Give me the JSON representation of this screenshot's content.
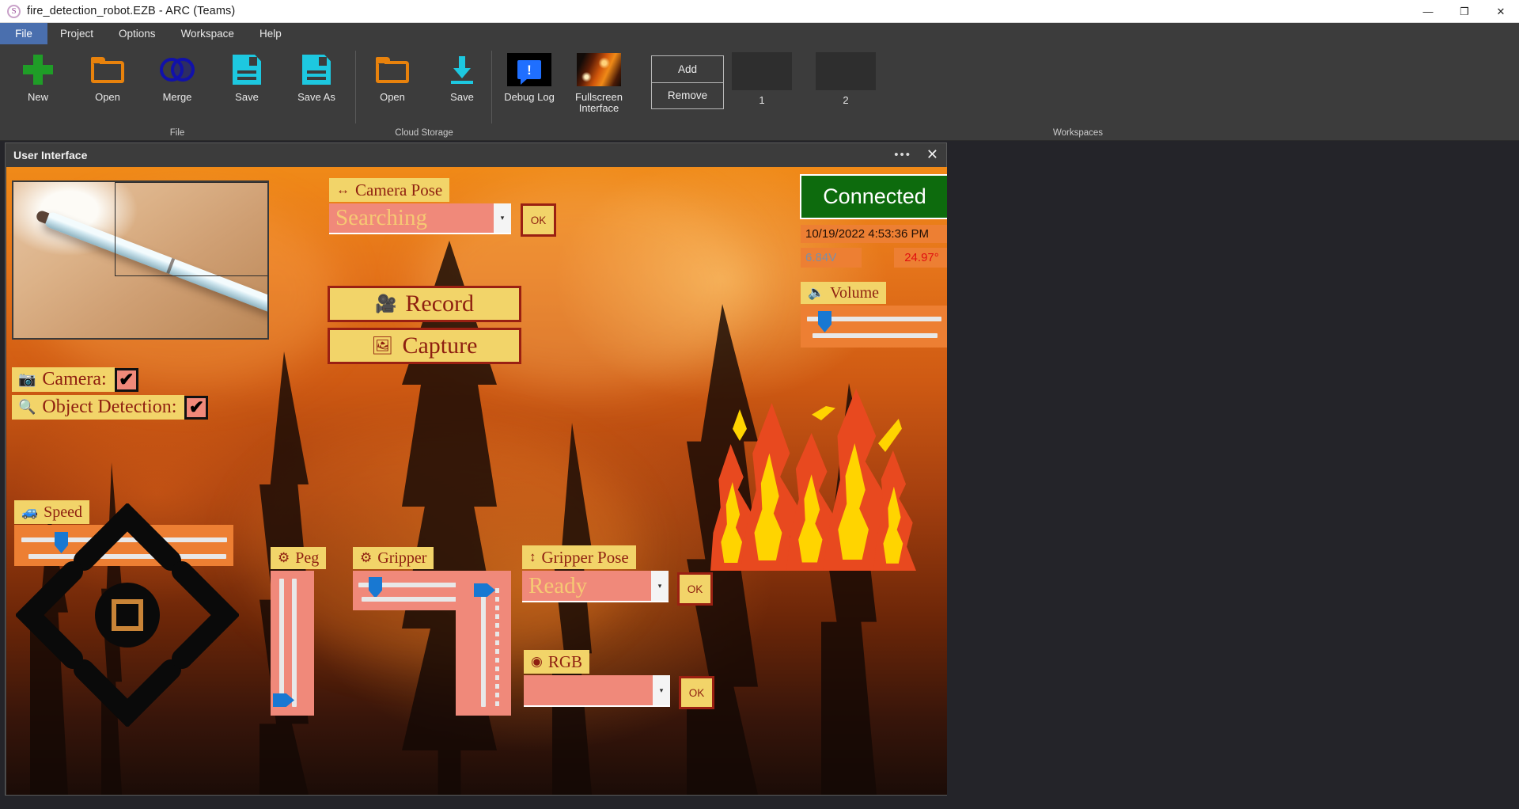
{
  "window": {
    "title": "fire_detection_robot.EZB - ARC (Teams)",
    "logo_glyph": "S",
    "minimize": "—",
    "maximize": "❐",
    "close": "✕"
  },
  "menu": {
    "items": [
      {
        "label": "File",
        "active": true
      },
      {
        "label": "Project",
        "active": false
      },
      {
        "label": "Options",
        "active": false
      },
      {
        "label": "Workspace",
        "active": false
      },
      {
        "label": "Help",
        "active": false
      }
    ]
  },
  "ribbon": {
    "groups": [
      {
        "label": "File"
      },
      {
        "label": "Cloud Storage"
      },
      {
        "label": "Workspaces"
      }
    ],
    "file_buttons": [
      {
        "label": "New",
        "icon": "plus-icon"
      },
      {
        "label": "Open",
        "icon": "folder-icon"
      },
      {
        "label": "Merge",
        "icon": "merge-circles-icon"
      },
      {
        "label": "Save",
        "icon": "floppy-disk-icon"
      },
      {
        "label": "Save As",
        "icon": "floppy-disk-icon"
      }
    ],
    "cloud_buttons": [
      {
        "label": "Open",
        "icon": "folder-icon"
      },
      {
        "label": "Save",
        "icon": "download-arrow-icon"
      }
    ],
    "tool_buttons": [
      {
        "label": "Debug Log",
        "icon": "debug-log-icon"
      },
      {
        "label": "Fullscreen Interface",
        "icon": "fullscreen-thumbnail-icon"
      }
    ],
    "workspace_actions": {
      "add": "Add",
      "remove": "Remove"
    },
    "workspace_thumbs": [
      {
        "label": "1"
      },
      {
        "label": "2"
      }
    ]
  },
  "ui_panel": {
    "title": "User Interface",
    "more_glyph": "•••",
    "close_glyph": "✕",
    "camera_pose": {
      "label": "Camera Pose",
      "icon": "left-right-arrow-icon",
      "value": "Searching",
      "ok_label": "OK",
      "arrow_glyph": "▾"
    },
    "record_button": {
      "label": "Record",
      "icon": "video-camera-icon"
    },
    "capture_button": {
      "label": "Capture",
      "icon": "photo-frame-icon"
    },
    "camera_checkbox": {
      "label": "Camera:",
      "icon": "camera-icon",
      "checked": true,
      "check_glyph": "✔"
    },
    "object_detection_checkbox": {
      "label": "Object Detection:",
      "icon": "magnifier-icon",
      "checked": true,
      "check_glyph": "✔"
    },
    "speed": {
      "label": "Speed",
      "icon": "vehicle-icon",
      "value_pct": 19
    },
    "dpad": {
      "up": "up-chevron",
      "down": "down-chevron",
      "left": "left-chevron",
      "right": "right-chevron",
      "stop": "stop-square"
    },
    "peg": {
      "label": "Peg",
      "icon": "gear-icon",
      "value_pct": 4
    },
    "gripper": {
      "label": "Gripper",
      "icon": "gear-icon",
      "value_pct": 12,
      "vertical_value_pct": 92
    },
    "gripper_pose": {
      "label": "Gripper Pose",
      "icon": "up-down-arrow-icon",
      "value": "Ready",
      "ok_label": "OK",
      "arrow_glyph": "▾"
    },
    "rgb": {
      "label": "RGB",
      "icon": "rgb-dots-icon",
      "value": "",
      "ok_label": "OK",
      "arrow_glyph": "▾"
    },
    "status": {
      "connection": "Connected",
      "timestamp": "10/19/2022 4:53:36 PM",
      "voltage": "6.84V",
      "temperature": "24.97°",
      "volume_label": "Volume",
      "volume_icon": "speaker-icon",
      "volume_pct": 16
    }
  },
  "colors": {
    "accent_yellow": "#f2d469",
    "accent_salmon": "#f0897a",
    "accent_orange": "#ed7f33",
    "label_text": "#8e1f10",
    "connected_green": "#0d6b0d",
    "slider_blue": "#1878d2",
    "temp_red": "#e01010"
  }
}
